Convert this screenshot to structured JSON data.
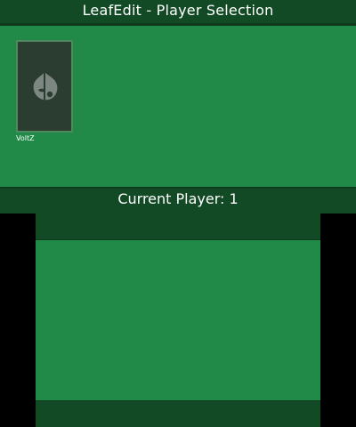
{
  "top_screen": {
    "title": "LeafEdit - Player Selection",
    "players": [
      {
        "name": "VoltZ",
        "icon": "leaf-icon"
      }
    ],
    "status_label": "Current Player: 1"
  },
  "colors": {
    "background": "#218a48",
    "bar": "#134a26",
    "card_fill": "#2a3d30",
    "card_border": "#4f8a5f",
    "text": "#ffffff"
  }
}
